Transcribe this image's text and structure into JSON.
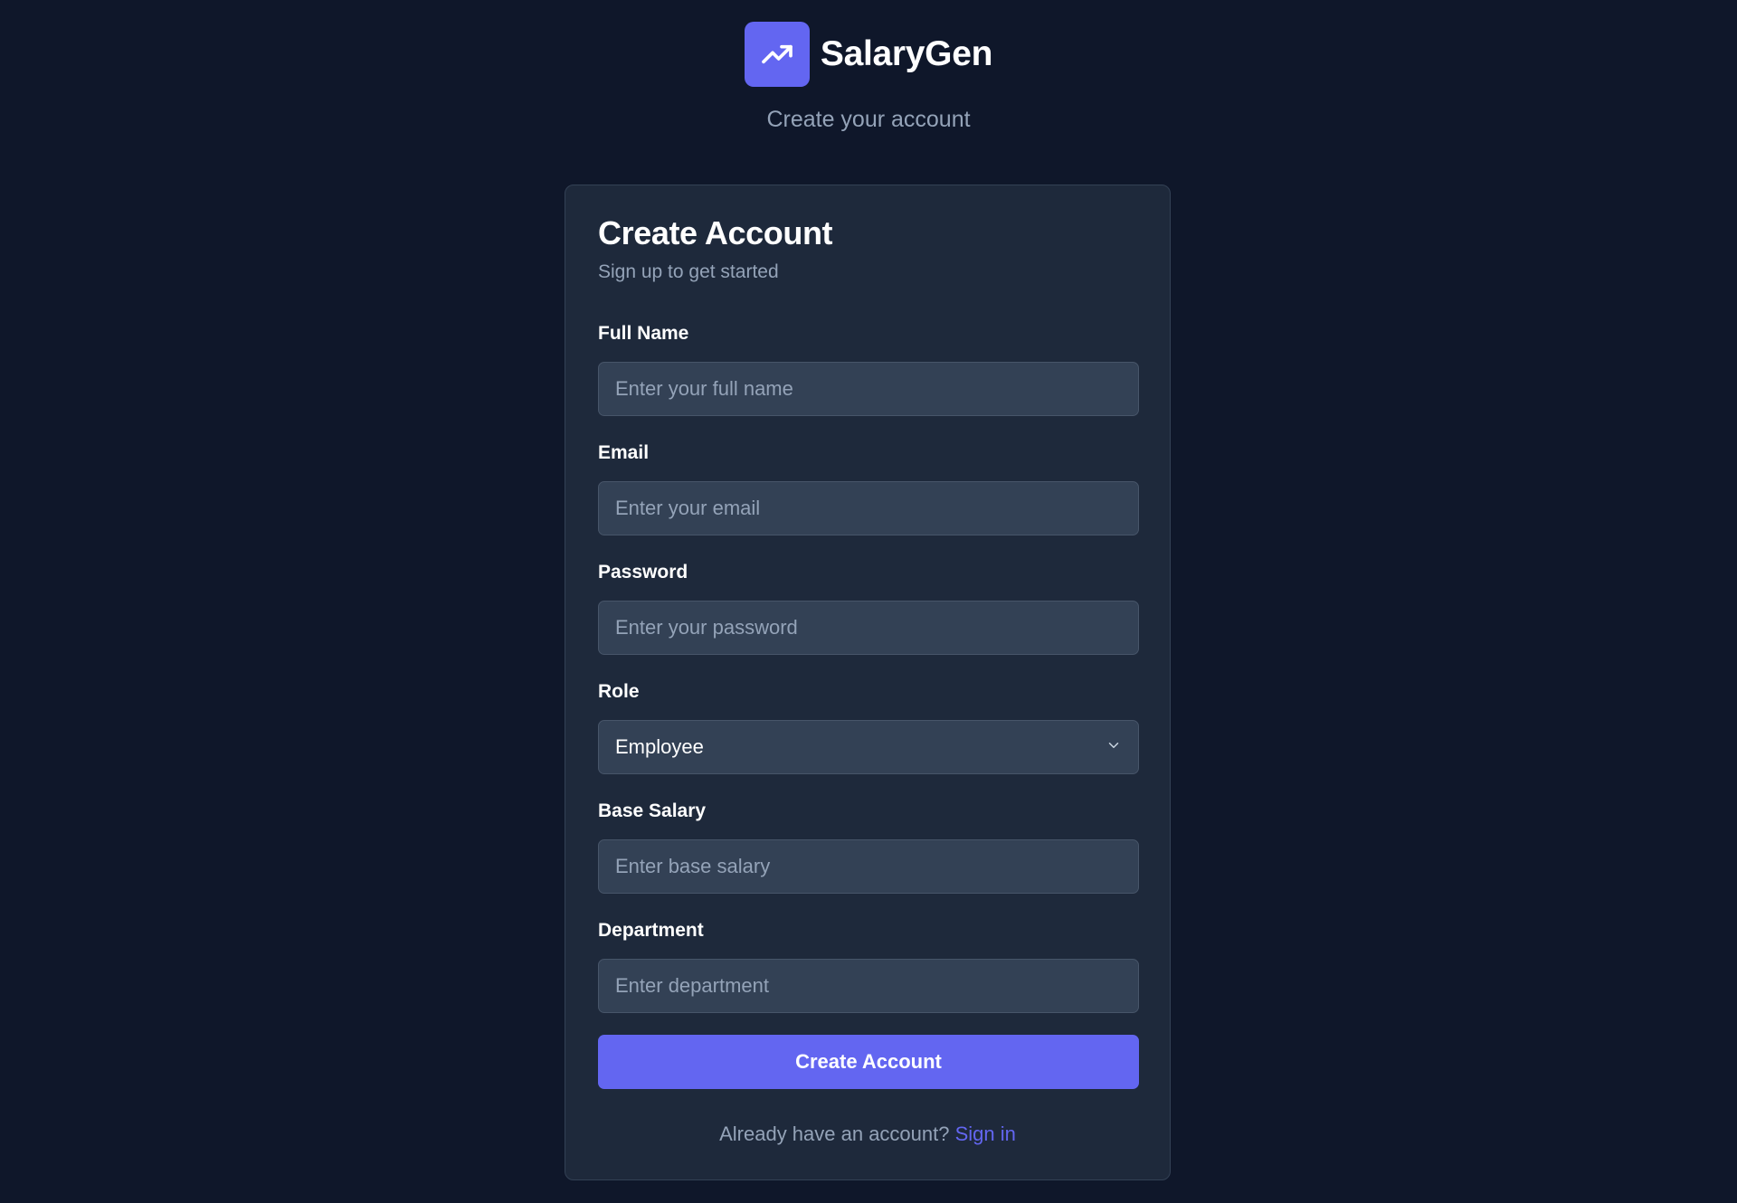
{
  "brand": {
    "app_name": "SalaryGen",
    "logo_icon": "trending-up-icon",
    "accent_color": "#6366f1",
    "tagline": "Create your account"
  },
  "form": {
    "title": "Create Account",
    "subtitle": "Sign up to get started",
    "full_name": {
      "label": "Full Name",
      "value": "",
      "placeholder": "Enter your full name"
    },
    "email": {
      "label": "Email",
      "value": "",
      "placeholder": "Enter your email"
    },
    "password": {
      "label": "Password",
      "value": "",
      "placeholder": "Enter your password"
    },
    "role": {
      "label": "Role",
      "selected": "Employee",
      "icon": "chevron-down-icon"
    },
    "base_salary": {
      "label": "Base Salary",
      "value": "",
      "placeholder": "Enter base salary"
    },
    "department": {
      "label": "Department",
      "value": "",
      "placeholder": "Enter department"
    },
    "submit_label": "Create Account",
    "footer_text": "Already have an account?",
    "signin_label": "Sign in"
  }
}
